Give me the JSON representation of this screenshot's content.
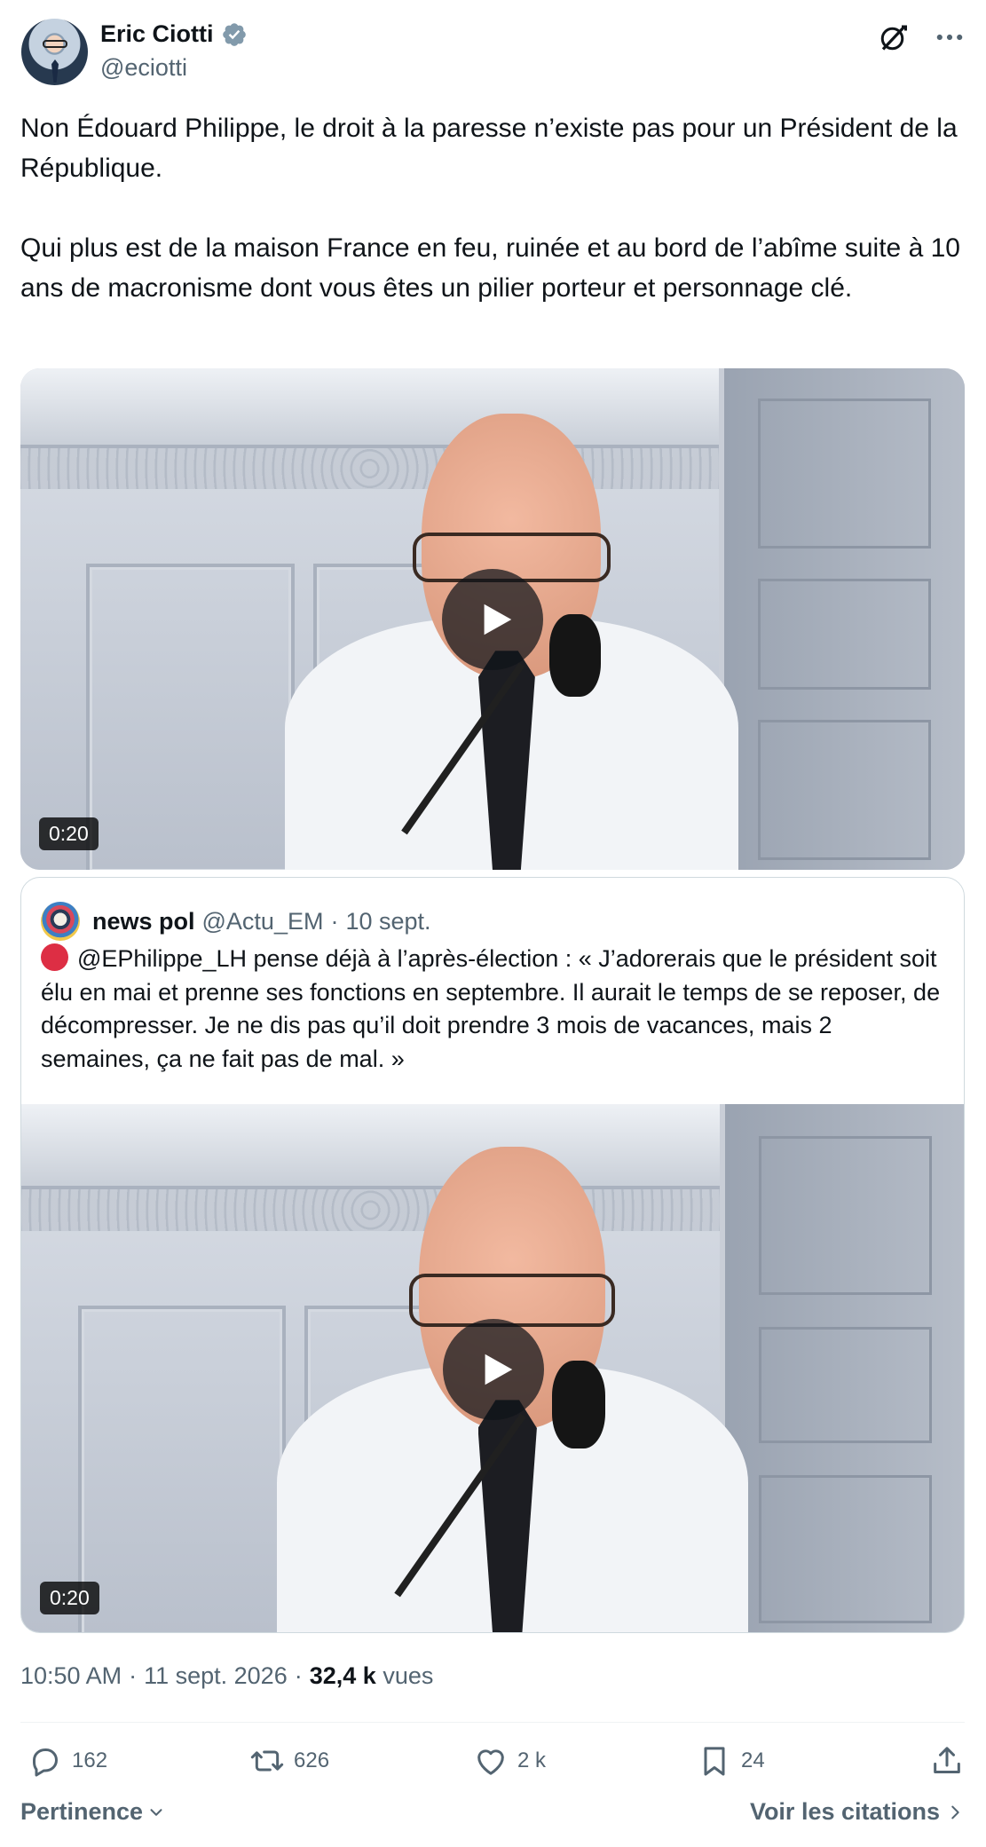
{
  "author": {
    "name": "Eric Ciotti",
    "handle": "@eciotti"
  },
  "tweet": {
    "text": "Non Édouard Philippe, le droit à la paresse n’existe pas pour un Président de la République.\n\nQui plus est de la maison France en feu, ruinée et au bord de l’abîme suite à 10 ans de macronisme dont vous êtes un pilier porteur et personnage clé."
  },
  "video_main": {
    "duration": "0:20"
  },
  "quoted": {
    "name": "news pol",
    "handle": "@Actu_EM",
    "separator": "·",
    "date": "10 sept.",
    "text": "@EPhilippe_LH pense déjà à l’après-élection : « J’adorerais que le président soit élu en mai et prenne ses fonctions en septembre. Il aurait le temps de se reposer, de décompresser. Je ne dis pas qu’il doit prendre 3 mois de vacances, mais 2 semaines, ça ne fait pas de mal. »",
    "video_duration": "0:20"
  },
  "meta": {
    "time": "10:50 AM",
    "sep1": "·",
    "date": "11 sept. 2026",
    "sep2": "·",
    "views_count": "32,4 k",
    "views_label": "vues"
  },
  "actions": {
    "replies": "162",
    "reposts": "626",
    "likes": "2 k",
    "bookmarks": "24"
  },
  "footer": {
    "sort_label": "Pertinence",
    "quotes_label": "Voir les citations"
  },
  "icons": {
    "verified": "verified-badge-icon",
    "grok": "grok-icon",
    "more": "more-icon",
    "play": "play-icon",
    "reply": "reply-icon",
    "repost": "repost-icon",
    "like": "heart-icon",
    "bookmark": "bookmark-icon",
    "share": "share-icon"
  },
  "colors": {
    "accent": "#1d9bf0",
    "text_primary": "#0f1419",
    "text_secondary": "#536471",
    "border": "#cfd9de",
    "verified": "#829aab",
    "live_dot": "#dd2e44"
  }
}
